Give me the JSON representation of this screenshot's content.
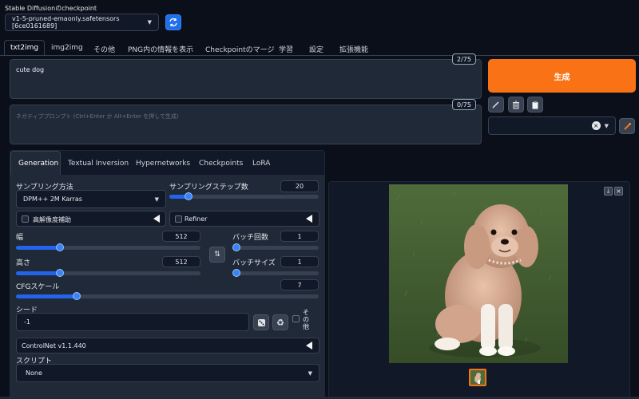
{
  "checkpoint": {
    "label": "Stable Diffusionのcheckpoint",
    "value": "v1-5-pruned-emaonly.safetensors [6ce0161689]"
  },
  "main_tabs": [
    "txt2img",
    "img2img",
    "その他",
    "PNG内の情報を表示",
    "Checkpointのマージ",
    "学習",
    "設定",
    "拡張機能"
  ],
  "prompt": {
    "value": "cute dog",
    "counter": "2/75"
  },
  "negative": {
    "placeholder": "ネガティブプロンプト (Ctrl+Enter か Alt+Enter を押して生成)",
    "counter": "0/75"
  },
  "generate_label": "生成",
  "sub_tabs": [
    "Generation",
    "Textual Inversion",
    "Hypernetworks",
    "Checkpoints",
    "LoRA"
  ],
  "sampler": {
    "label": "サンプリング方法",
    "value": "DPM++ 2M Karras"
  },
  "steps": {
    "label": "サンプリングステップ数",
    "value": "20",
    "fraction": 0.13
  },
  "hires": {
    "label": "高解像度補助"
  },
  "refiner": {
    "label": "Refiner"
  },
  "width": {
    "label": "幅",
    "value": "512",
    "fraction": 0.24
  },
  "height": {
    "label": "高さ",
    "value": "512",
    "fraction": 0.24
  },
  "batch_count": {
    "label": "バッチ回数",
    "value": "1",
    "fraction": 0.0
  },
  "batch_size": {
    "label": "バッチサイズ",
    "value": "1",
    "fraction": 0.0
  },
  "cfg": {
    "label": "CFGスケール",
    "value": "7",
    "fraction": 0.2
  },
  "seed": {
    "label": "シード",
    "value": "-1",
    "extra_label": "その他"
  },
  "controlnet": {
    "label": "ControlNet v1.1.440"
  },
  "script": {
    "label": "スクリプト",
    "value": "None"
  },
  "colors": {
    "accent": "#f97316",
    "slider": "#2563eb",
    "bg": "#0b0f19"
  },
  "icons": [
    "refresh-icon",
    "pencil-icon",
    "trash-icon",
    "clipboard-icon",
    "brush-icon",
    "swap-icon",
    "dice-icon",
    "recycle-icon",
    "download-icon",
    "close-icon"
  ]
}
